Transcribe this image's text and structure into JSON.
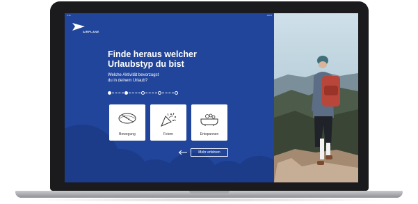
{
  "statusbar": {
    "time": "9:41",
    "battery": "100%"
  },
  "brand": {
    "name": "AIRPLANE",
    "color": "#21459b"
  },
  "quiz": {
    "headline_line1": "Finde heraus welcher",
    "headline_line2": "Urlaubstyp du bist",
    "question_line1": "Welche Aktivität bevorzugst",
    "question_line2": "du in deinem Urlaub?",
    "progress": {
      "current_step": 2,
      "total_steps": 5
    },
    "options": [
      {
        "label": "Bewegung",
        "icon": "rugby-ball-icon"
      },
      {
        "label": "Feiern",
        "icon": "party-popper-icon"
      },
      {
        "label": "Entspannen",
        "icon": "bathtub-icon"
      }
    ],
    "back_icon": "arrow-left-icon",
    "more_button_label": "Mehr erfahren"
  },
  "photo": {
    "subject": "hiker-on-mountain-photo"
  }
}
